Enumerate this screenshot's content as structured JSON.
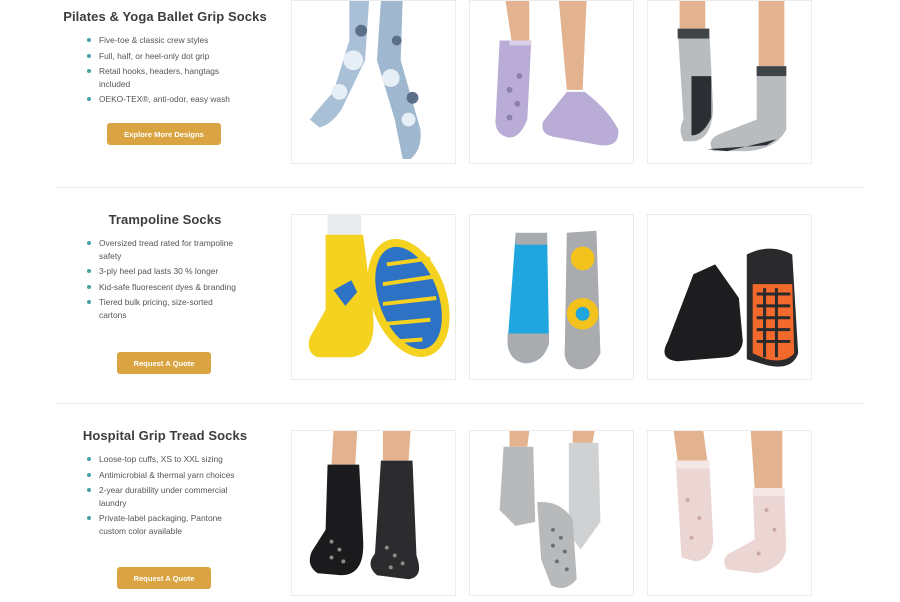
{
  "sections": [
    {
      "title": "Pilates & Yoga Ballet Grip Socks",
      "features": [
        "Five-toe & classic crew styles",
        "Full, half, or heel-only dot grip",
        "Retail hooks, headers, hangtags included",
        "OEKO-TEX®, anti-odor, easy wash"
      ],
      "cta": "Explore More Designs",
      "images": [
        {
          "icon": "tie-dye-crew-grip-sock-image",
          "colors": {
            "sock": "#9fb7cf",
            "accent": "#e6eef6",
            "grip": "#5b6f8a"
          }
        },
        {
          "icon": "lavender-toe-grip-sock-image",
          "colors": {
            "sock": "#b9acd6",
            "accent": "#d8cfe8",
            "grip": "#8d80ae"
          }
        },
        {
          "icon": "grey-crew-grip-sock-image",
          "colors": {
            "sock": "#b9bcbf",
            "accent": "#3e4347",
            "grip": "#2b2f33"
          }
        }
      ]
    },
    {
      "title": "Trampoline Socks",
      "features": [
        "Oversized tread rated for trampoline safety",
        "3-ply heel pad lasts 30 % longer",
        "Kid-safe fluorescent dyes & branding",
        "Tiered bulk pricing, size-sorted cartons"
      ],
      "cta": "Request A Quote",
      "images": [
        {
          "icon": "yellow-trampoline-sock-image",
          "colors": {
            "sock": "#f4d21f",
            "accent": "#ffffff",
            "grip": "#2d72c5"
          }
        },
        {
          "icon": "blue-branded-trampoline-sock-image",
          "colors": {
            "sock": "#1fa6df",
            "accent": "#a9abae",
            "grip": "#f3c21c"
          }
        },
        {
          "icon": "black-orange-grip-sock-image",
          "colors": {
            "sock": "#1d1d1f",
            "accent": "#2a2a2c",
            "grip": "#f26a2b"
          }
        }
      ]
    },
    {
      "title": "Hospital Grip Tread Socks",
      "features": [
        "Loose-top cuffs, XS to XXL sizing",
        "Antimicrobial & thermal yarn choices",
        "2-year durability under commercial laundry",
        "Private-label packaging, Pantone custom color available"
      ],
      "cta": "Request A Quote",
      "images": [
        {
          "icon": "black-hospital-grip-sock-image",
          "colors": {
            "sock": "#1b1b1d",
            "accent": "#2c2c2e",
            "grip": "#8a8a8a"
          }
        },
        {
          "icon": "grey-hospital-grip-sock-image",
          "colors": {
            "sock": "#b7b9bb",
            "accent": "#cfd1d3",
            "grip": "#6d7073"
          }
        },
        {
          "icon": "pink-fuzzy-grip-sock-image",
          "colors": {
            "sock": "#ecd6d4",
            "accent": "#f5e7e5",
            "grip": "#c9a8a5"
          }
        }
      ]
    }
  ],
  "colors": {
    "button": "#d9a441",
    "bullet": "#4aa0a8",
    "divider": "#ececec",
    "skin": "#e2b38e"
  }
}
